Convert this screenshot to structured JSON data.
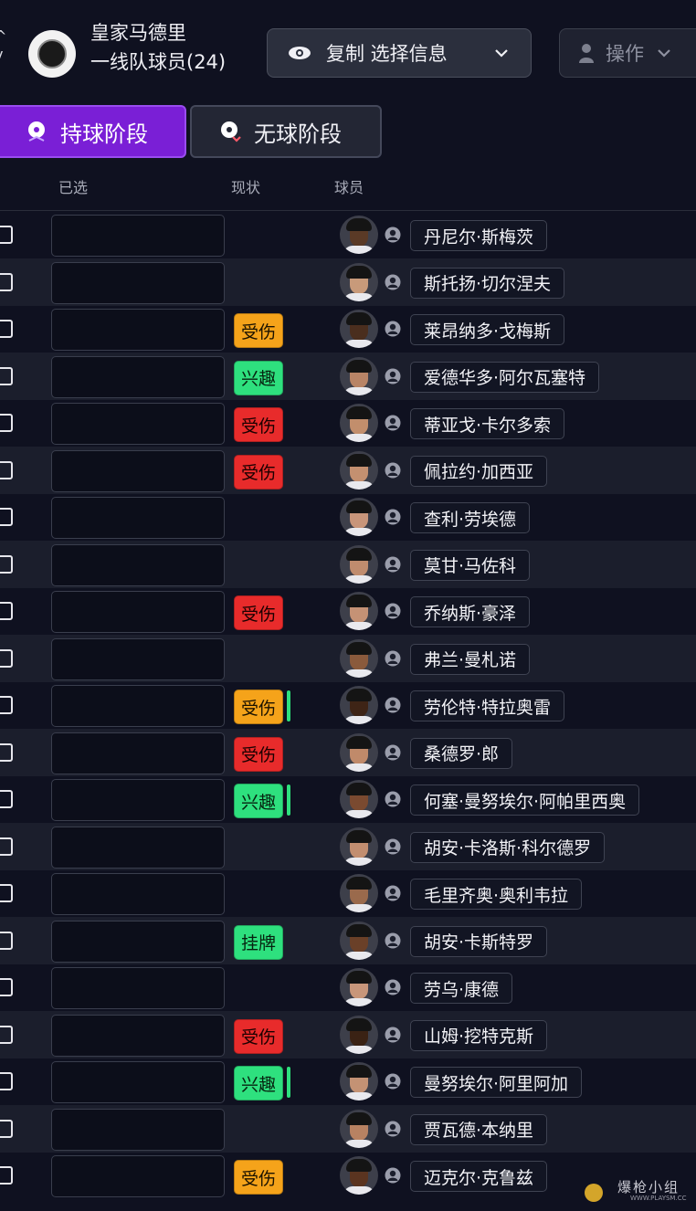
{
  "header": {
    "club_name": "皇家马德里",
    "squad_label": "一线队球员(24)",
    "copy_button_label": "复制 选择信息",
    "action_button_label": "操作"
  },
  "tabs": [
    {
      "label": "持球阶段",
      "active": true
    },
    {
      "label": "无球阶段",
      "active": false
    }
  ],
  "columns": {
    "selected": "已选",
    "status": "现状",
    "player": "球员"
  },
  "status_colors": {
    "injured_orange": "#f5a31a",
    "injured_red": "#e82b2b",
    "interest": "#2ee07e",
    "listed": "#2ee07e"
  },
  "players": [
    {
      "name": "丹尼尔·斯梅茨",
      "status": "",
      "status_type": "empty",
      "has_bar": false,
      "skin": "#5a3a26"
    },
    {
      "name": "斯托扬·切尔涅夫",
      "status": "",
      "status_type": "empty",
      "has_bar": false,
      "skin": "#c89a7a"
    },
    {
      "name": "莱昂纳多·戈梅斯",
      "status": "受伤",
      "status_type": "injured-orange",
      "has_bar": false,
      "skin": "#4a2e1e"
    },
    {
      "name": "爱德华多·阿尔瓦塞特",
      "status": "兴趣",
      "status_type": "interest",
      "has_bar": false,
      "skin": "#b88466"
    },
    {
      "name": "蒂亚戈·卡尔多索",
      "status": "受伤",
      "status_type": "injured-red",
      "has_bar": false,
      "skin": "#c28e6c"
    },
    {
      "name": "佩拉约·加西亚",
      "status": "受伤",
      "status_type": "injured-red",
      "has_bar": false,
      "skin": "#c49070"
    },
    {
      "name": "查利·劳埃德",
      "status": "",
      "status_type": "empty",
      "has_bar": false,
      "skin": "#c8957a"
    },
    {
      "name": "莫甘·马佐科",
      "status": "",
      "status_type": "empty",
      "has_bar": false,
      "skin": "#c08c6e"
    },
    {
      "name": "乔纳斯·豪泽",
      "status": "受伤",
      "status_type": "injured-red",
      "has_bar": false,
      "skin": "#c59275"
    },
    {
      "name": "弗兰·曼札诺",
      "status": "",
      "status_type": "empty",
      "has_bar": false,
      "skin": "#8a5a3c"
    },
    {
      "name": "劳伦特·特拉奥雷",
      "status": "受伤",
      "status_type": "injured-orange",
      "has_bar": true,
      "skin": "#3e2416"
    },
    {
      "name": "桑德罗·郎",
      "status": "受伤",
      "status_type": "injured-red",
      "has_bar": false,
      "skin": "#c08a6a"
    },
    {
      "name": "何塞·曼努埃尔·阿帕里西奥",
      "status": "兴趣",
      "status_type": "interest",
      "has_bar": true,
      "skin": "#7a4a30"
    },
    {
      "name": "胡安·卡洛斯·科尔德罗",
      "status": "",
      "status_type": "empty",
      "has_bar": false,
      "skin": "#c28e70"
    },
    {
      "name": "毛里齐奥·奥利韦拉",
      "status": "",
      "status_type": "empty",
      "has_bar": false,
      "skin": "#9a6a4c"
    },
    {
      "name": "胡安·卡斯特罗",
      "status": "挂牌",
      "status_type": "listed",
      "has_bar": false,
      "skin": "#6a4028"
    },
    {
      "name": "劳乌·康德",
      "status": "",
      "status_type": "empty",
      "has_bar": false,
      "skin": "#c8967a"
    },
    {
      "name": "山姆·挖特克斯",
      "status": "受伤",
      "status_type": "injured-red",
      "has_bar": false,
      "skin": "#3a2214"
    },
    {
      "name": "曼努埃尔·阿里阿加",
      "status": "兴趣",
      "status_type": "interest",
      "has_bar": true,
      "skin": "#c49274"
    },
    {
      "name": "贾瓦德·本纳里",
      "status": "",
      "status_type": "empty",
      "has_bar": false,
      "skin": "#b88262"
    },
    {
      "name": "迈克尔·克鲁兹",
      "status": "受伤",
      "status_type": "injured-orange",
      "has_bar": false,
      "skin": "#5a3420"
    }
  ],
  "watermark": {
    "text": "爆枪小组",
    "url": "WWW.PLAYSM.CC"
  }
}
